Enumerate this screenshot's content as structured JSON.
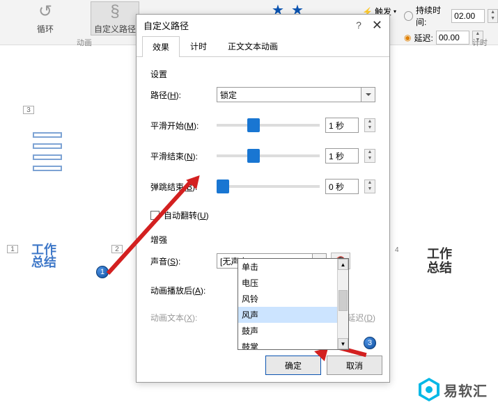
{
  "ribbon": {
    "loop_label": "循环",
    "custom_path_label": "自定义路径",
    "anim_section": "动画",
    "trigger_label": "触发",
    "duration_label": "持续时间:",
    "duration_value": "02.00",
    "delay_label": "延迟:",
    "delay_value": "00.00",
    "timing_section": "计时"
  },
  "slides": {
    "s3": "3",
    "s1": "1",
    "s2": "2",
    "s4": "4",
    "text_blue": "工作\n总结",
    "text_side": "工作\n总结"
  },
  "dialog": {
    "title": "自定义路径",
    "tabs": {
      "effect": "效果",
      "timing": "计时",
      "text_anim": "正文文本动画"
    },
    "settings_label": "设置",
    "path_label": "路径(",
    "path_u": "H",
    "path_after": "):",
    "path_value": "锁定",
    "smooth_start_label": "平滑开始(",
    "smooth_start_u": "M",
    "smooth_start_after": "):",
    "smooth_start_value": "1 秒",
    "smooth_end_label": "平滑结束(",
    "smooth_end_u": "N",
    "smooth_end_after": "):",
    "smooth_end_value": "1 秒",
    "bounce_end_label": "弹跳结束(",
    "bounce_end_u": "B",
    "bounce_end_after": "):",
    "bounce_end_value": "0 秒",
    "auto_rev_label": "自动翻转(",
    "auto_rev_u": "U",
    "auto_rev_after": ")",
    "enhance_label": "增强",
    "sound_label": "声音(",
    "sound_u": "S",
    "sound_after": "):",
    "sound_value": "[无声音]",
    "after_anim_label": "动画播放后(",
    "after_anim_u": "A",
    "after_anim_after": "):",
    "anim_text_label": "动画文本(",
    "anim_text_u": "X",
    "anim_text_after": "):",
    "delay_link": "间延迟(",
    "delay_link_u": "D",
    "delay_link_after": ")",
    "options": [
      "单击",
      "电压",
      "风铃",
      "风声",
      "鼓声",
      "鼓掌"
    ],
    "ok": "确定",
    "cancel": "取消"
  },
  "badges": {
    "n1": "1",
    "n2": "2",
    "n3": "3"
  },
  "brand": "易软汇"
}
